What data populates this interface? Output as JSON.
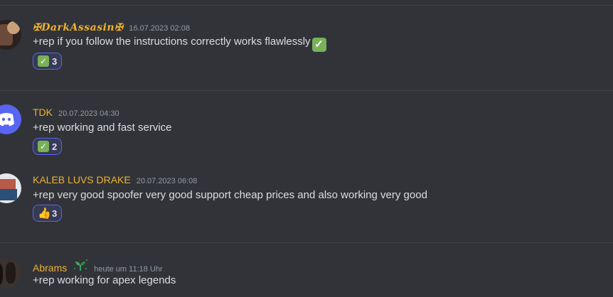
{
  "messages": [
    {
      "author": "✠𝑫𝒂𝒓𝒌𝑨𝒔𝒔𝒂𝒔𝒊𝒏✠",
      "timestamp": "16.07.2023 02:08",
      "text": "+rep if you follow the instructions correctly works flawlessly",
      "reaction": {
        "emoji": "check-mark-icon",
        "count": "3"
      }
    },
    {
      "author": "TDK",
      "timestamp": "20.07.2023 04:30",
      "text": "+rep working and fast service",
      "reaction": {
        "emoji": "check-mark-icon",
        "count": "2"
      }
    },
    {
      "author": "KALEB LUVS DRAKE",
      "timestamp": "20.07.2023 06:08",
      "text": "+rep very good spoofer very good support cheap prices and also working very good",
      "reaction": {
        "emoji": "thumbs-up-icon",
        "count": "3"
      }
    },
    {
      "author": "Abrams",
      "timestamp": "heute um 11:18 Uhr",
      "text": "+rep working for apex legends"
    }
  ],
  "colors": {
    "background": "#313338",
    "username": "#f0b232",
    "reaction_border": "#5865f2",
    "check": "#78b159"
  }
}
